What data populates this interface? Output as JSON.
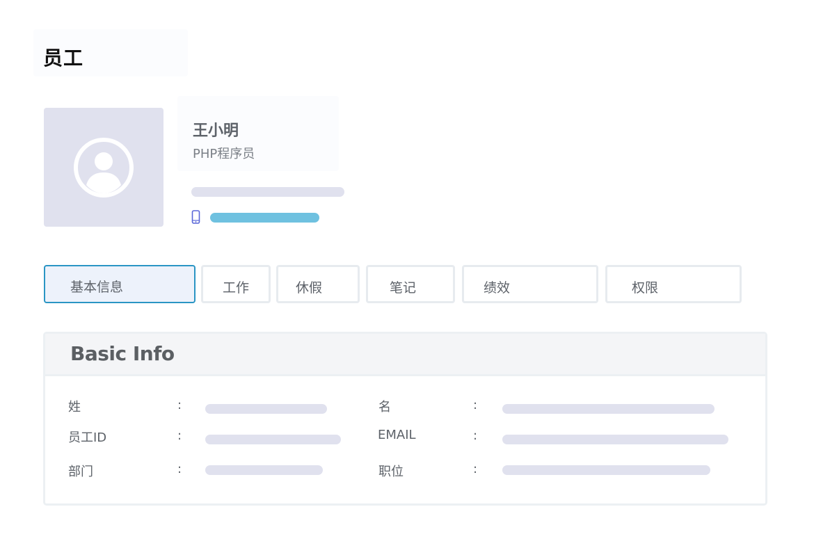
{
  "page": {
    "title": "员工"
  },
  "profile": {
    "name": "王小明",
    "role": "PHP程序员",
    "avatar_icon": "user-avatar-icon",
    "phone_icon": "mobile-phone-icon",
    "accent_color": "#2a95c4",
    "phone_bar_color": "#6fc1e0",
    "placeholder_color": "#e0e1ee"
  },
  "tabs": [
    {
      "label": "基本信息",
      "active": true
    },
    {
      "label": "工作",
      "active": false
    },
    {
      "label": "休假",
      "active": false
    },
    {
      "label": "笔记",
      "active": false
    },
    {
      "label": "绩效",
      "active": false
    },
    {
      "label": "权限",
      "active": false
    }
  ],
  "basic_info": {
    "title": "Basic Info",
    "separator": ":",
    "fields": [
      {
        "label": "姓"
      },
      {
        "label": "名"
      },
      {
        "label": "员工ID"
      },
      {
        "label": "EMAIL"
      },
      {
        "label": "部门"
      },
      {
        "label": "职位"
      }
    ]
  }
}
